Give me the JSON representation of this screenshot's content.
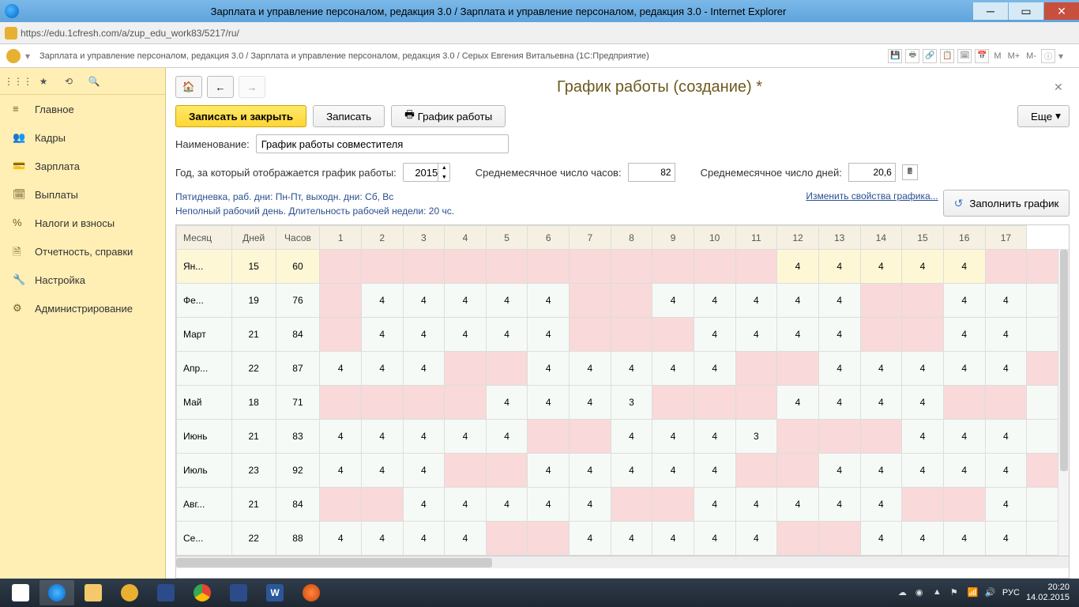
{
  "window": {
    "title": "Зарплата и управление персоналом, редакция 3.0 / Зарплата и управление персоналом, редакция 3.0 - Internet Explorer",
    "url": "https://edu.1cfresh.com/a/zup_edu_work83/5217/ru/"
  },
  "app": {
    "crumb": "Зарплата и управление персоналом, редакция 3.0 / Зарплата и управление персоналом, редакция 3.0 / Серых Евгения Витальевна (1С:Предприятие)",
    "tm": "М",
    "tm_plus": "М+",
    "tm_minus": "М-"
  },
  "sidebar": {
    "items": [
      {
        "label": "Главное"
      },
      {
        "label": "Кадры"
      },
      {
        "label": "Зарплата"
      },
      {
        "label": "Выплаты"
      },
      {
        "label": "Налоги и взносы"
      },
      {
        "label": "Отчетность, справки"
      },
      {
        "label": "Настройка"
      },
      {
        "label": "Администрирование"
      }
    ]
  },
  "page": {
    "title": "График работы (создание) *",
    "save_close": "Записать и закрыть",
    "save": "Записать",
    "print": "График работы",
    "more": "Еще",
    "name_label": "Наименование:",
    "name_value": "График работы совместителя",
    "year_label": "Год, за который отображается график работы:",
    "year_value": "2015",
    "avg_hours_label": "Среднемесячное число часов:",
    "avg_hours_value": "82",
    "avg_days_label": "Среднемесячное число дней:",
    "avg_days_value": "20,6",
    "desc_line1": "Пятидневка, раб. дни: Пн-Пт, выходн. дни: Сб, Вс",
    "desc_line2": "Неполный рабочий день. Длительность рабочей недели: 20 чс.",
    "link_change": "Изменить свойства графика...",
    "btn_fill": "Заполнить график"
  },
  "grid": {
    "headers": [
      "Месяц",
      "Дней",
      "Часов",
      "1",
      "2",
      "3",
      "4",
      "5",
      "6",
      "7",
      "8",
      "9",
      "10",
      "11",
      "12",
      "13",
      "14",
      "15",
      "16",
      "17"
    ],
    "rows": [
      {
        "month": "Ян...",
        "days": "15",
        "hours": "60",
        "cells": [
          "",
          "",
          "",
          "",
          "",
          "",
          "",
          "",
          "",
          "",
          "",
          "4",
          "4",
          "4",
          "4",
          "4",
          "",
          ""
        ],
        "weekends": [
          0,
          1,
          2,
          3,
          4,
          5,
          6,
          7,
          8,
          9,
          10,
          16,
          17
        ]
      },
      {
        "month": "Фе...",
        "days": "19",
        "hours": "76",
        "cells": [
          "",
          "4",
          "4",
          "4",
          "4",
          "4",
          "",
          "",
          "4",
          "4",
          "4",
          "4",
          "4",
          "",
          "",
          "4",
          "4",
          ""
        ],
        "weekends": [
          0,
          6,
          7,
          13,
          14
        ]
      },
      {
        "month": "Март",
        "days": "21",
        "hours": "84",
        "cells": [
          "",
          "4",
          "4",
          "4",
          "4",
          "4",
          "",
          "",
          "",
          "4",
          "4",
          "4",
          "4",
          "",
          "",
          "4",
          "4",
          ""
        ],
        "weekends": [
          0,
          6,
          7,
          8,
          13,
          14
        ]
      },
      {
        "month": "Апр...",
        "days": "22",
        "hours": "87",
        "cells": [
          "4",
          "4",
          "4",
          "",
          "",
          "4",
          "4",
          "4",
          "4",
          "4",
          "",
          "",
          "4",
          "4",
          "4",
          "4",
          "4",
          ""
        ],
        "weekends": [
          3,
          4,
          10,
          11,
          17
        ]
      },
      {
        "month": "Май",
        "days": "18",
        "hours": "71",
        "cells": [
          "",
          "",
          "",
          "",
          "4",
          "4",
          "4",
          "3",
          "",
          "",
          "",
          "4",
          "4",
          "4",
          "4",
          "",
          "",
          ""
        ],
        "weekends": [
          0,
          1,
          2,
          3,
          8,
          9,
          10,
          15,
          16
        ]
      },
      {
        "month": "Июнь",
        "days": "21",
        "hours": "83",
        "cells": [
          "4",
          "4",
          "4",
          "4",
          "4",
          "",
          "",
          "4",
          "4",
          "4",
          "3",
          "",
          "",
          "",
          "4",
          "4",
          "4",
          ""
        ],
        "weekends": [
          5,
          6,
          11,
          12,
          13
        ]
      },
      {
        "month": "Июль",
        "days": "23",
        "hours": "92",
        "cells": [
          "4",
          "4",
          "4",
          "",
          "",
          "4",
          "4",
          "4",
          "4",
          "4",
          "",
          "",
          "4",
          "4",
          "4",
          "4",
          "4",
          ""
        ],
        "weekends": [
          3,
          4,
          10,
          11,
          17
        ]
      },
      {
        "month": "Авг...",
        "days": "21",
        "hours": "84",
        "cells": [
          "",
          "",
          "4",
          "4",
          "4",
          "4",
          "4",
          "",
          "",
          "4",
          "4",
          "4",
          "4",
          "4",
          "",
          "",
          "4",
          ""
        ],
        "weekends": [
          0,
          1,
          7,
          8,
          14,
          15
        ]
      },
      {
        "month": "Се...",
        "days": "22",
        "hours": "88",
        "cells": [
          "4",
          "4",
          "4",
          "4",
          "",
          "",
          "4",
          "4",
          "4",
          "4",
          "4",
          "",
          "",
          "4",
          "4",
          "4",
          "4",
          ""
        ],
        "weekends": [
          4,
          5,
          11,
          12
        ]
      }
    ]
  },
  "tray": {
    "lang": "РУС",
    "time": "20:20",
    "date": "14.02.2015"
  }
}
